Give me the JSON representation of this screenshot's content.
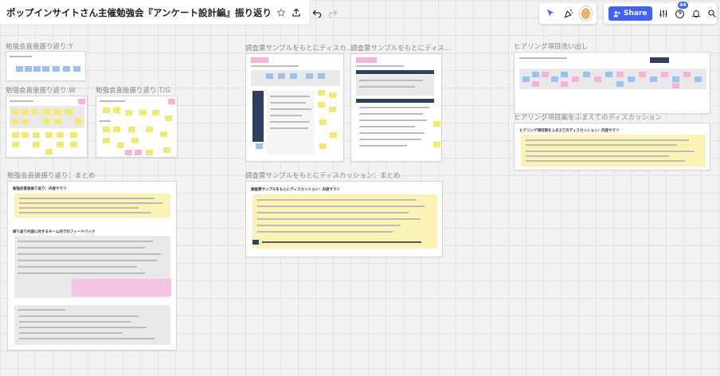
{
  "board": {
    "title": "ポップインサイトさん主催勉強会『アンケート設計編』振り返り"
  },
  "header": {
    "share_label": "Share",
    "notification_count": "44"
  },
  "icons": {
    "star": "star-icon",
    "upload": "upload-icon",
    "undo": "undo-icon",
    "redo": "redo-icon",
    "cursor": "cursor-icon",
    "celebrate": "party-icon",
    "settings": "sliders-icon",
    "help": "help-icon",
    "bell": "bell-icon",
    "search": "search-icon"
  },
  "frames": {
    "f1": {
      "label": "勉強会直後振り返り:Y"
    },
    "f2": {
      "label": "勉強会直後振り返り:W"
    },
    "f3": {
      "label": "勉強会直後振り返り:T/G"
    },
    "f4": {
      "label": "勉強会直後振り返り：まとめ",
      "title": "勉強会直後振り返り：内容サマリ",
      "sub": "振り返り内容に対するチーム内でのフィードバック"
    },
    "f5": {
      "label": "調査票サンプルをもとにディスカ..."
    },
    "f6": {
      "label": "調査票サンプルをもとにディス..."
    },
    "f7": {
      "label": "調査票サンプルをもとにディスカッション：まとめ",
      "title": "調査票サンプルをもとにディスカッション：内容サマリ"
    },
    "f8": {
      "label": "ヒアリング項目洗い出し"
    },
    "f9": {
      "label": "ヒアリング項目案をふまえてのディスカッション",
      "title": "ヒアリング項目案をふまえてのディスカッション：内容サマリ"
    }
  }
}
